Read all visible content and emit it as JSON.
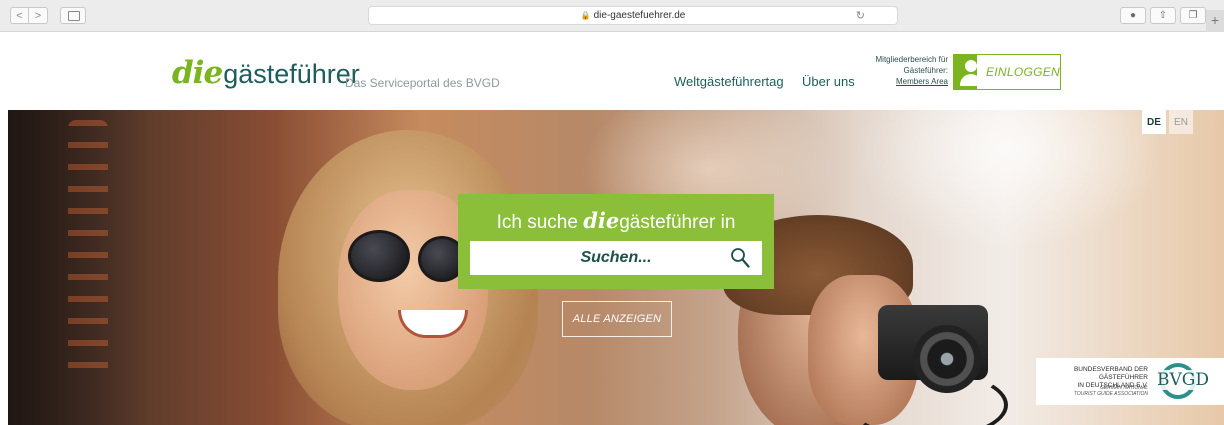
{
  "browser": {
    "url": "die-gaestefuehrer.de",
    "back_glyph": "<",
    "forward_glyph": ">",
    "new_tab_glyph": "+"
  },
  "site": {
    "logo_die": "die",
    "logo_rest": "gästeführer",
    "tagline": "Das Serviceportal des BVGD",
    "nav": {
      "item1": "Weltgästeführertag",
      "item2": "Über uns"
    },
    "members": {
      "line1": "Mitgliederbereich für",
      "line2": "Gästeführer:",
      "link": "Members Area"
    },
    "login_label": "EINLOGGEN",
    "colors": {
      "brand_green": "#7ab41e",
      "brand_teal": "#1d5e5c",
      "search_green": "#8bbf3a"
    }
  },
  "hero": {
    "lang_de": "DE",
    "lang_en": "EN",
    "search_prefix": "Ich suche ",
    "search_die": "die",
    "search_brand": "gästeführer",
    "search_suffix": " in",
    "search_placeholder": "Suchen...",
    "all_button": "ALLE ANZEIGEN",
    "bvgd": {
      "line1": "BUNDESVERBAND DER GÄSTEFÜHRER",
      "line2": "IN DEUTSCHLAND E.V.",
      "line3": "GERMAN NATIONAL",
      "line4": "TOURIST GUIDE ASSOCIATION",
      "logo": "BVGD"
    }
  }
}
